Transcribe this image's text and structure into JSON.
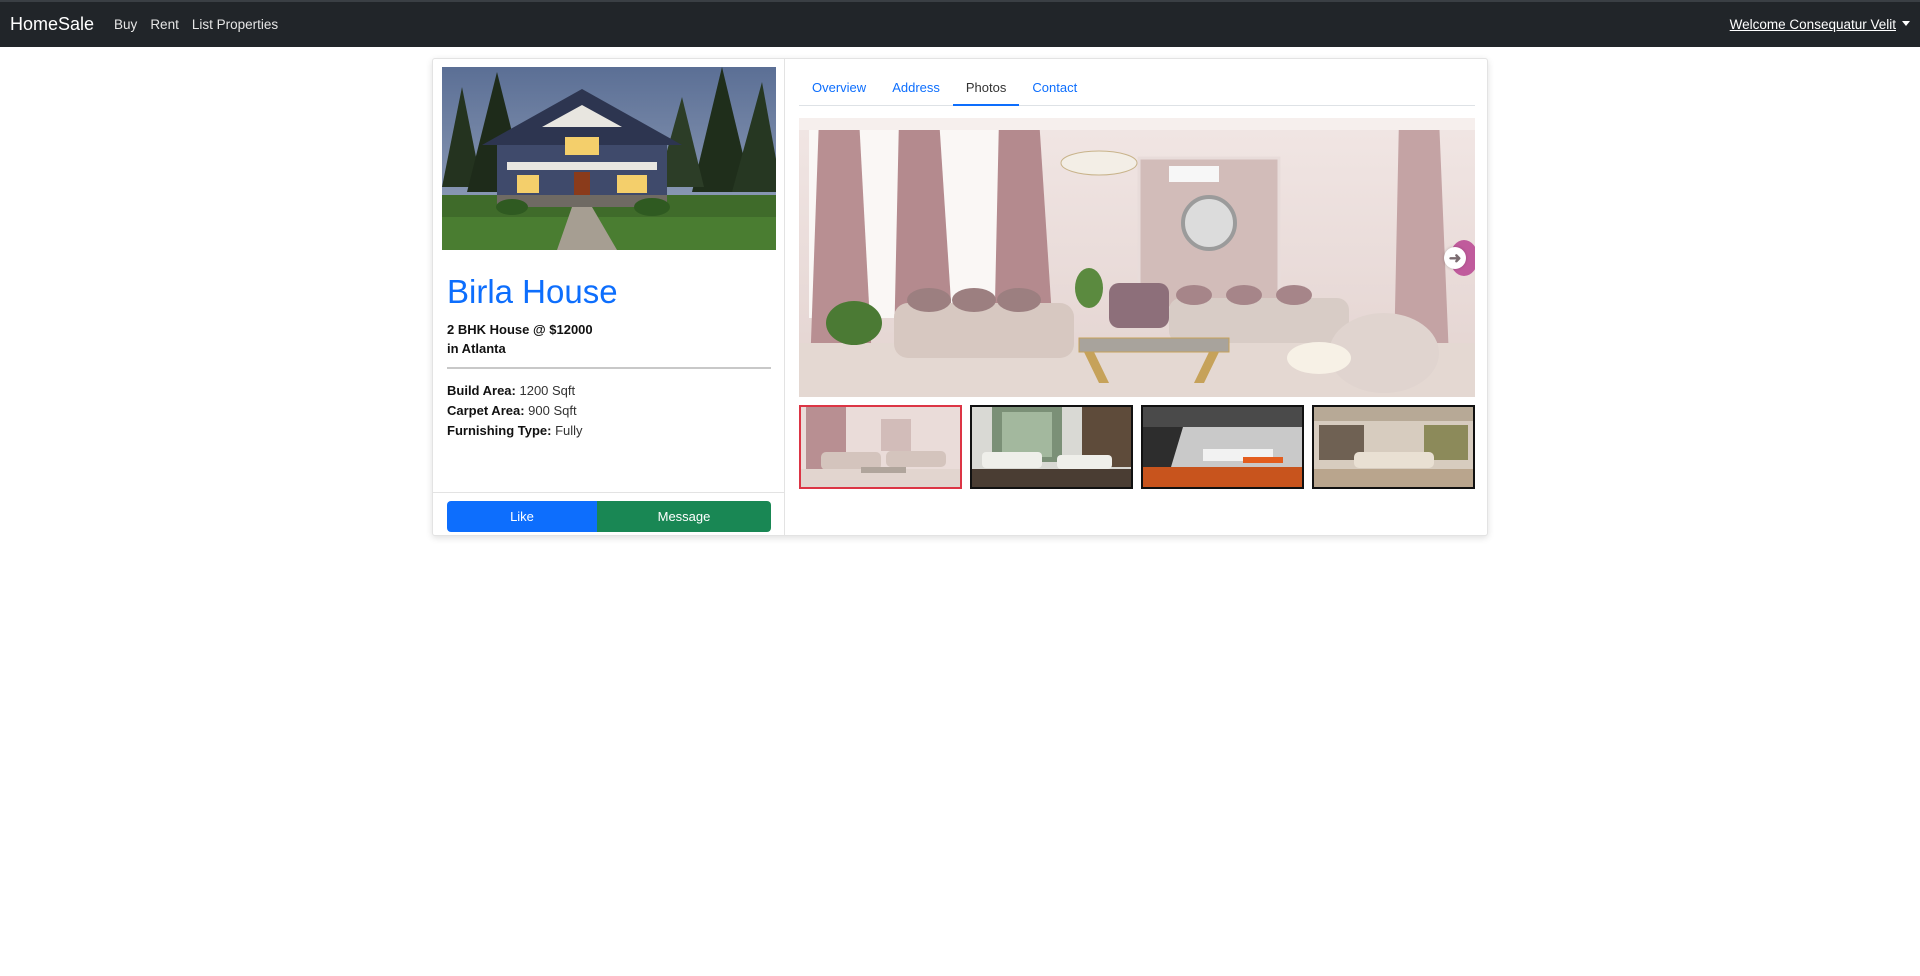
{
  "navbar": {
    "brand": "HomeSale",
    "links": [
      "Buy",
      "Rent",
      "List Properties"
    ],
    "welcome": "Welcome Consequatur Velit"
  },
  "property": {
    "title": "Birla House",
    "subtitle_line1": "2 BHK House @ $12000",
    "subtitle_line2": "in Atlanta",
    "build_area_label": "Build Area:",
    "build_area_value": "1200 Sqft",
    "carpet_area_label": "Carpet Area:",
    "carpet_area_value": "900 Sqft",
    "furnishing_label": "Furnishing Type:",
    "furnishing_value": "Fully"
  },
  "actions": {
    "like_label": "Like",
    "message_label": "Message"
  },
  "tabs": [
    "Overview",
    "Address",
    "Photos",
    "Contact"
  ],
  "active_tab": "Photos",
  "gallery": {
    "selected_index": 0,
    "next_icon": "arrow-right-circle-icon",
    "thumbnails": [
      "living-room-pink",
      "living-room-glass",
      "living-room-stairs",
      "living-room-beige"
    ]
  },
  "colors": {
    "navbar_bg": "#212529",
    "primary": "#0d6efd",
    "success": "#198754",
    "selected_border": "#dc3545"
  }
}
